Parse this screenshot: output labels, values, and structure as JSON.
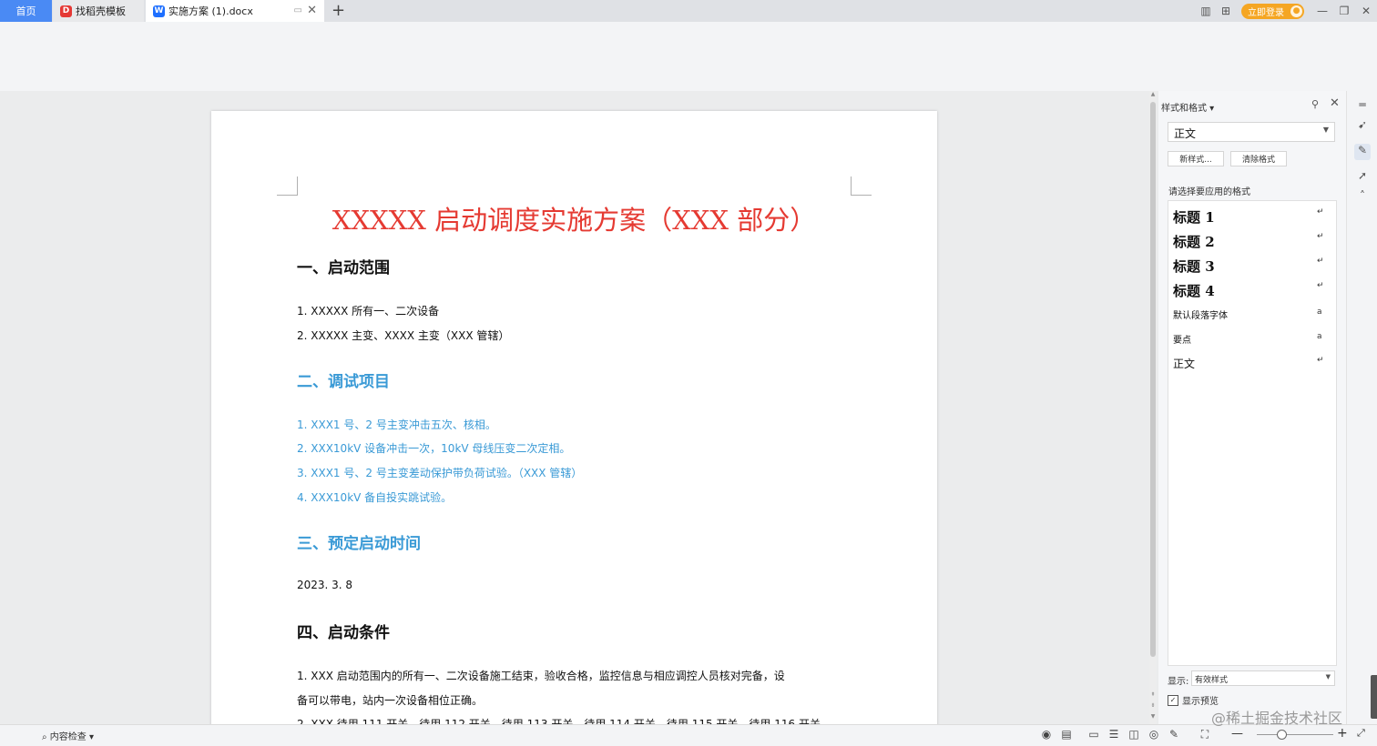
{
  "tabs": {
    "home": "首页",
    "templates": "找稻壳模板",
    "document": "实施方案 (1).docx",
    "new_tab": "+"
  },
  "topbar": {
    "login": "立即登录"
  },
  "document": {
    "title": "XXXXX 启动调度实施方案（XXX 部分）",
    "section1": {
      "heading": "一、启动范围",
      "items": [
        "1. XXXXX 所有一、二次设备",
        "2. XXXXX 主变、XXXX 主变（XXX 管辖）"
      ]
    },
    "section2": {
      "heading": "二、调试项目",
      "items": [
        "1. XXX1 号、2 号主变冲击五次、核相。",
        "2. XXX10kV 设备冲击一次，10kV 母线压变二次定相。",
        "3. XXX1 号、2 号主变差动保护带负荷试验。（XXX 管辖）",
        "4. XXX10kV 备自投实跳试验。"
      ]
    },
    "section3": {
      "heading": "三、预定启动时间",
      "date": "2023. 3. 8"
    },
    "section4": {
      "heading": "四、启动条件",
      "item1_line1": "1. XXX 启动范围内的所有一、二次设备施工结束，验收合格，监控信息与相应调控人员核对完备，设",
      "item1_line2": "备可以带电，站内一次设备相位正确。",
      "item2_partial": "2. XXX 待用 111 开关、待用 112 开关、待用 113 开关、待用 114 开关、待用 115 开关、待用 116 开关"
    }
  },
  "panel": {
    "title": "样式和格式",
    "current_style": "正文",
    "new_style_button": "新样式...",
    "clear_format_button": "清除格式",
    "choose_label": "请选择要应用的格式",
    "styles": [
      {
        "label": "标题  1",
        "marker": "↵"
      },
      {
        "label": "标题  2",
        "marker": "↵"
      },
      {
        "label": "标题  3",
        "marker": "↵"
      },
      {
        "label": "标题  4",
        "marker": "↵"
      },
      {
        "label": "默认段落字体",
        "marker": "a"
      },
      {
        "label": "要点",
        "marker": "a"
      },
      {
        "label": "正文",
        "marker": "↵"
      }
    ],
    "show_label": "显示:",
    "show_value": "有效样式",
    "preview_label": "显示预览",
    "preview_checked": true
  },
  "statusbar": {
    "content_check": "内容检查"
  },
  "watermark": "@稀土掘金技术社区",
  "colors": {
    "accent": "#4a8af4",
    "title_red": "#e53a32",
    "heading_blue": "#3a9ad6",
    "login_orange": "#f5a623"
  }
}
